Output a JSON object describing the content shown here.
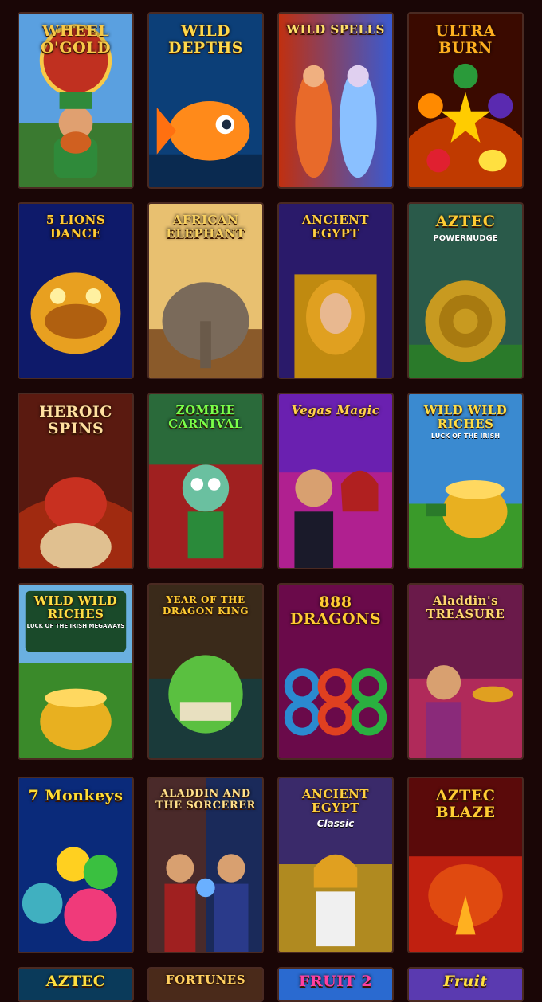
{
  "games": [
    {
      "title": "WHEEL O'GOLD",
      "sub": "",
      "colors": {
        "bg1": "#5aa0e0",
        "bg2": "#3a7a30",
        "fg": "#f7c948",
        "art": "#2f8a3a"
      },
      "icon": "leprechaun-icon"
    },
    {
      "title": "WILD DEPTHS",
      "sub": "",
      "colors": {
        "bg1": "#0c3f78",
        "bg2": "#0a2a50",
        "fg": "#ffd84a",
        "art": "#ff8a1a"
      },
      "icon": "goldfish-icon"
    },
    {
      "title": "WILD SPELLS",
      "sub": "",
      "colors": {
        "bg1": "#6a2bd0",
        "bg2": "#b0204a",
        "fg": "#ffe06a",
        "art": "#ff6a2a"
      },
      "icon": "sorceresses-icon"
    },
    {
      "title": "ULTRA BURN",
      "sub": "",
      "colors": {
        "bg1": "#3a0a00",
        "bg2": "#c03a00",
        "fg": "#ffb020",
        "art": "#ffcc00"
      },
      "icon": "fruit-star-icon"
    },
    {
      "title": "5 LIONS DANCE",
      "sub": "",
      "colors": {
        "bg1": "#0e1a6a",
        "bg2": "#1a2a8a",
        "fg": "#ffcc33",
        "art": "#e8a020"
      },
      "icon": "lion-mask-icon"
    },
    {
      "title": "AFRICAN ELEPHANT",
      "sub": "",
      "colors": {
        "bg1": "#e8c070",
        "bg2": "#8a5a2a",
        "fg": "#f7d060",
        "art": "#7a6a5a"
      },
      "icon": "elephant-icon"
    },
    {
      "title": "ANCIENT EGYPT",
      "sub": "",
      "colors": {
        "bg1": "#2a1a6a",
        "bg2": "#c08a10",
        "fg": "#ffd040",
        "art": "#e0a020"
      },
      "icon": "cleopatra-icon"
    },
    {
      "title": "AZTEC",
      "sub": "POWERNUDGE",
      "colors": {
        "bg1": "#2a5a4a",
        "bg2": "#2a7a2a",
        "fg": "#ffcc33",
        "art": "#c89a20"
      },
      "icon": "aztec-calendar-icon"
    },
    {
      "title": "HEROIC SPINS",
      "sub": "",
      "colors": {
        "bg1": "#5a1a10",
        "bg2": "#a02a10",
        "fg": "#ffe0a0",
        "art": "#c83020"
      },
      "icon": "dragon-icon"
    },
    {
      "title": "ZOMBIE CARNIVAL",
      "sub": "",
      "colors": {
        "bg1": "#2a6a3a",
        "bg2": "#a02020",
        "fg": "#7aff4a",
        "art": "#6ac0a0"
      },
      "icon": "zombie-clown-icon"
    },
    {
      "title": "Vegas Magic",
      "sub": "",
      "colors": {
        "bg1": "#6a20b0",
        "bg2": "#b02090",
        "fg": "#ffd24a",
        "art": "#d8a070"
      },
      "icon": "magicians-icon"
    },
    {
      "title": "WILD WILD RICHES",
      "sub": "LUCK OF THE IRISH",
      "colors": {
        "bg1": "#3a8ad0",
        "bg2": "#3a9a2a",
        "fg": "#ffdd44",
        "art": "#e8b020"
      },
      "icon": "pot-of-gold-icon"
    },
    {
      "title": "WILD WILD RICHES",
      "sub": "LUCK OF THE IRISH MEGAWAYS",
      "colors": {
        "bg1": "#6ab0e0",
        "bg2": "#3a8a2a",
        "fg": "#ffdd44",
        "art": "#e8b020"
      },
      "icon": "pot-of-gold-icon"
    },
    {
      "title": "YEAR OF THE DRAGON KING",
      "sub": "",
      "colors": {
        "bg1": "#3a2a1a",
        "bg2": "#1a3a3a",
        "fg": "#ffcc33",
        "art": "#5ac040"
      },
      "icon": "dragon-mask-icon"
    },
    {
      "title": "888 DRAGONS",
      "sub": "",
      "colors": {
        "bg1": "#6a0a4a",
        "bg2": "#4a0a3a",
        "fg": "#ffcc33",
        "art": "#2a8ad0"
      },
      "icon": "dragons-888-icon"
    },
    {
      "title": "Aladdin's TREASURE",
      "sub": "",
      "colors": {
        "bg1": "#6a1a4a",
        "bg2": "#b02a5a",
        "fg": "#ffd870",
        "art": "#e0a020"
      },
      "icon": "aladdin-lamp-icon"
    },
    {
      "title": "7 Monkeys",
      "sub": "",
      "colors": {
        "bg1": "#0a2a7a",
        "bg2": "#1a4aa0",
        "fg": "#ffdd33",
        "art": "#f08aa0"
      },
      "icon": "monkeys-icon"
    },
    {
      "title": "ALADDIN AND THE SORCERER",
      "sub": "",
      "colors": {
        "bg1": "#4a2a2a",
        "bg2": "#1a2a5a",
        "fg": "#ffe08a",
        "art": "#3a6ad0"
      },
      "icon": "sorcerer-icon"
    },
    {
      "title": "ANCIENT EGYPT",
      "sub": "Classic",
      "colors": {
        "bg1": "#3a2a6a",
        "bg2": "#b08a20",
        "fg": "#ffd040",
        "art": "#e0a020"
      },
      "icon": "cleopatra-icon"
    },
    {
      "title": "AZTEC BLAZE",
      "sub": "",
      "colors": {
        "bg1": "#5a0a0a",
        "bg2": "#c02010",
        "fg": "#ffcc33",
        "art": "#e04a10"
      },
      "icon": "fire-bird-icon"
    },
    {
      "title": "AZTEC",
      "sub": "",
      "colors": {
        "bg1": "#0a3a5a",
        "bg2": "#0a5a4a",
        "fg": "#ffe040",
        "art": "#e0b020"
      },
      "icon": "aztec-icon"
    },
    {
      "title": "FORTUNES",
      "sub": "",
      "colors": {
        "bg1": "#4a2a1a",
        "bg2": "#3a1a0a",
        "fg": "#ffd060",
        "art": "#c09040"
      },
      "icon": "fortune-icon"
    },
    {
      "title": "FRUIT 2",
      "sub": "",
      "colors": {
        "bg1": "#2a6ad0",
        "bg2": "#1a3a8a",
        "fg": "#ff40a0",
        "art": "#ff40a0"
      },
      "icon": "fruit-icon"
    },
    {
      "title": "Fruit",
      "sub": "",
      "colors": {
        "bg1": "#5a3ab0",
        "bg2": "#3a2a8a",
        "fg": "#ffe040",
        "art": "#ffe040"
      },
      "icon": "fruit-icon"
    }
  ]
}
